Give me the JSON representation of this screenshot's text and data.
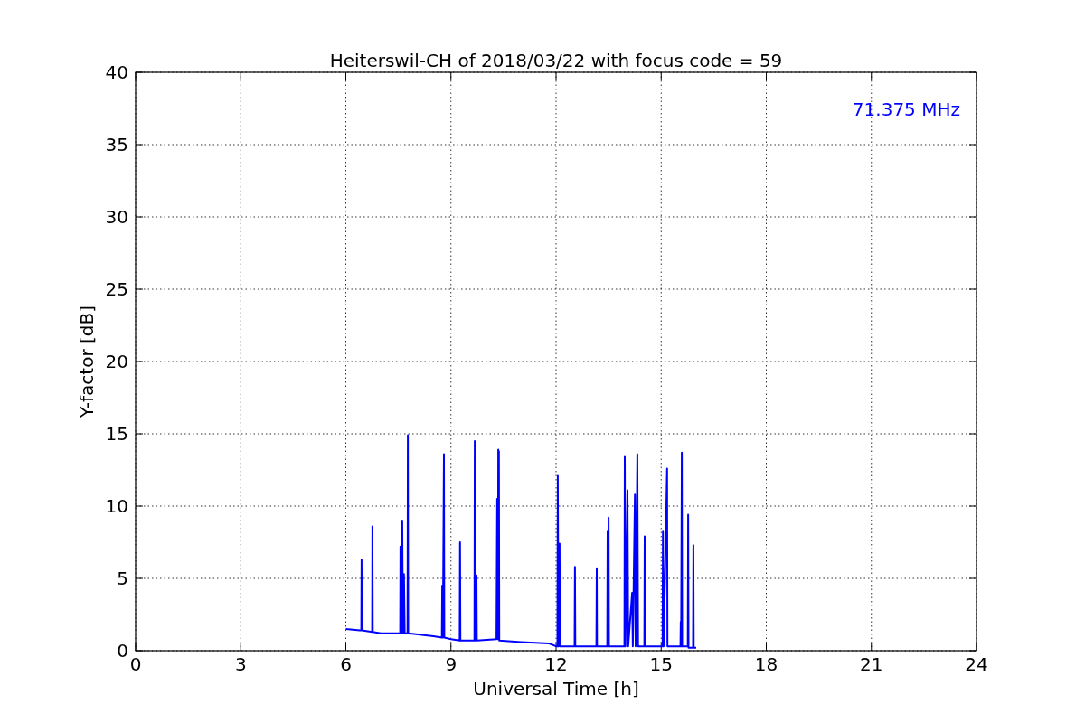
{
  "chart_data": {
    "type": "line",
    "title": "Heiterswil-CH of 2018/03/22 with focus code = 59",
    "xlabel": "Universal Time [h]",
    "ylabel": "Y-factor [dB]",
    "x": [
      6.0,
      6.4,
      6.44,
      6.45,
      6.46,
      6.75,
      6.76,
      6.77,
      7.0,
      7.55,
      7.56,
      7.58,
      7.61,
      7.63,
      7.66,
      7.68,
      7.76,
      7.77,
      7.78,
      8.5,
      8.74,
      8.75,
      8.77,
      8.8,
      8.81,
      9.0,
      9.25,
      9.26,
      9.27,
      9.67,
      9.68,
      9.7,
      9.73,
      9.74,
      10.3,
      10.32,
      10.34,
      10.35,
      10.36,
      10.37,
      10.38,
      11.0,
      11.8,
      12.0,
      12.04,
      12.05,
      12.07,
      12.1,
      12.11,
      12.53,
      12.54,
      12.55,
      13.15,
      13.16,
      13.17,
      13.46,
      13.47,
      13.49,
      13.5,
      13.51,
      13.95,
      13.96,
      13.98,
      14.04,
      14.06,
      14.17,
      14.19,
      14.25,
      14.27,
      14.32,
      14.34,
      14.52,
      14.53,
      14.54,
      15.04,
      15.05,
      15.07,
      15.17,
      15.18,
      15.55,
      15.56,
      15.57,
      15.59,
      15.6,
      15.76,
      15.77,
      15.78,
      15.91,
      15.92,
      15.93,
      16.0
    ],
    "series": [
      {
        "name": "71.375 MHz",
        "color": "#0000ff",
        "values": [
          1.5,
          1.4,
          1.4,
          6.3,
          1.4,
          1.3,
          8.6,
          1.3,
          1.2,
          1.2,
          7.2,
          1.2,
          9.0,
          1.2,
          5.3,
          1.2,
          1.2,
          14.9,
          1.2,
          1.0,
          0.9,
          4.5,
          0.9,
          13.6,
          0.9,
          0.8,
          0.7,
          7.5,
          0.7,
          0.7,
          14.5,
          0.7,
          5.2,
          0.7,
          0.8,
          10.5,
          0.8,
          13.9,
          0.8,
          13.8,
          0.7,
          0.6,
          0.5,
          0.3,
          0.3,
          12.1,
          0.3,
          7.4,
          0.3,
          0.3,
          5.8,
          0.3,
          0.3,
          5.7,
          0.3,
          0.3,
          8.3,
          0.3,
          9.2,
          0.3,
          0.3,
          13.4,
          0.3,
          11.1,
          0.3,
          4.0,
          0.3,
          10.8,
          0.3,
          13.6,
          0.3,
          0.3,
          7.9,
          0.3,
          0.3,
          8.3,
          0.3,
          12.6,
          0.3,
          0.3,
          2.0,
          0.3,
          13.7,
          0.3,
          0.3,
          9.4,
          0.2,
          0.2,
          7.3,
          0.2,
          0.2
        ]
      }
    ],
    "xlim": [
      0,
      24
    ],
    "ylim": [
      0,
      40
    ],
    "xticks": [
      0,
      3,
      6,
      9,
      12,
      15,
      18,
      21,
      24
    ],
    "yticks": [
      0,
      5,
      10,
      15,
      20,
      25,
      30,
      35,
      40
    ],
    "grid": true
  }
}
